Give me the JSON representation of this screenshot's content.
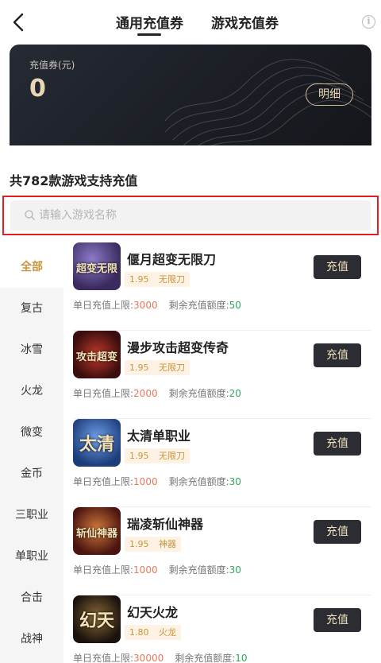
{
  "header": {
    "tabs": [
      {
        "label": "通用充值券",
        "active": true
      },
      {
        "label": "游戏充值券",
        "active": false
      }
    ]
  },
  "card": {
    "label": "充值券(元)",
    "value": "0",
    "detail_button": "明细"
  },
  "list": {
    "count_text": "共782款游戏支持充值",
    "search_placeholder": "请输入游戏名称"
  },
  "sidebar": {
    "items": [
      {
        "label": "全部",
        "active": true
      },
      {
        "label": "复古"
      },
      {
        "label": "冰雪"
      },
      {
        "label": "火龙"
      },
      {
        "label": "微变"
      },
      {
        "label": "金币"
      },
      {
        "label": "三职业"
      },
      {
        "label": "单职业"
      },
      {
        "label": "合击"
      },
      {
        "label": "战神"
      }
    ]
  },
  "games": [
    {
      "name": "偃月超变无限刀",
      "price": "1.95",
      "category": "无限刀",
      "daily_label": "单日充值上限:",
      "daily_value": "3000",
      "remain_label": "剩余充值额度:",
      "remain_value": "50",
      "button": "充值",
      "thumb_text": "超变无限",
      "thumb_color": "#3a2a5e"
    },
    {
      "name": "漫步攻击超变传奇",
      "price": "1.95",
      "category": "无限刀",
      "daily_label": "单日充值上限:",
      "daily_value": "2000",
      "remain_label": "剩余充值额度:",
      "remain_value": "20",
      "button": "充值",
      "thumb_text": "攻击超变",
      "thumb_color": "#5a1414"
    },
    {
      "name": "太清单职业",
      "price": "1.95",
      "category": "无限刀",
      "daily_label": "单日充值上限:",
      "daily_value": "1000",
      "remain_label": "剩余充值额度:",
      "remain_value": "30",
      "button": "充值",
      "thumb_text": "太清",
      "thumb_color": "#1d3c7a"
    },
    {
      "name": "瑞凌斩仙神器",
      "price": "1.95",
      "category": "神器",
      "daily_label": "单日充值上限:",
      "daily_value": "1000",
      "remain_label": "剩余充值额度:",
      "remain_value": "30",
      "button": "充值",
      "thumb_text": "斩仙神器",
      "thumb_color": "#6a1f1a"
    },
    {
      "name": "幻天火龙",
      "price": "1.80",
      "category": "火龙",
      "daily_label": "单日充值上限:",
      "daily_value": "30000",
      "remain_label": "剩余充值额度:",
      "remain_value": "10",
      "button": "充值",
      "thumb_text": "幻天",
      "thumb_color": "#2a1e14"
    }
  ]
}
